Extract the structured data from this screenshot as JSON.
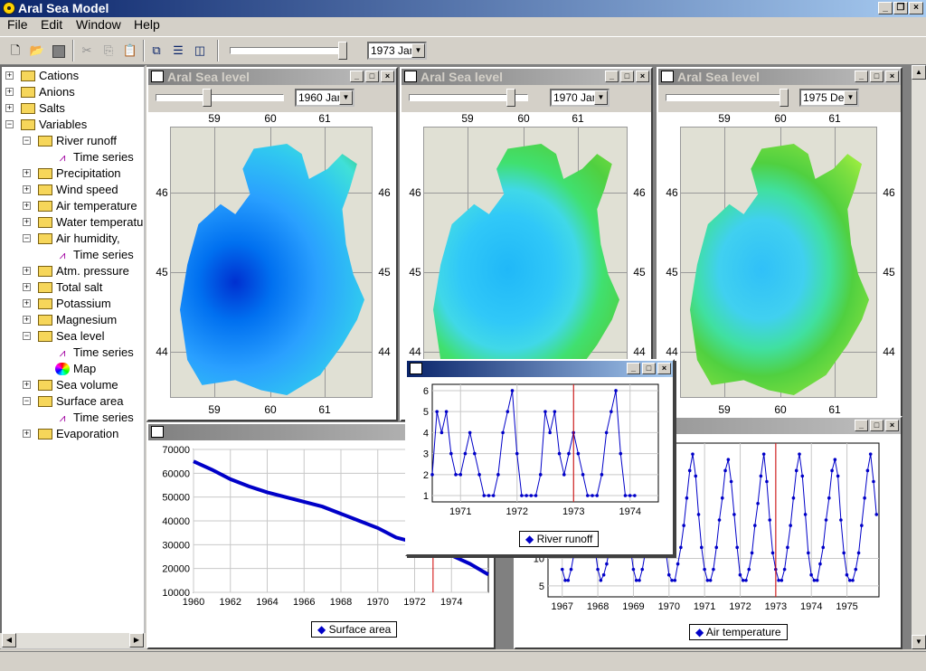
{
  "app": {
    "title": "Aral Sea Model"
  },
  "menu": [
    "File",
    "Edit",
    "Window",
    "Help"
  ],
  "toolbar": {
    "time_select": "1973 Jan"
  },
  "tree": {
    "items": [
      {
        "label": "Cations",
        "level": 0,
        "type": "folder",
        "expander": "+"
      },
      {
        "label": "Anions",
        "level": 0,
        "type": "folder",
        "expander": "+"
      },
      {
        "label": "Salts",
        "level": 0,
        "type": "folder",
        "expander": "+"
      },
      {
        "label": "Variables",
        "level": 0,
        "type": "folder",
        "expander": "-"
      },
      {
        "label": "River runoff",
        "level": 1,
        "type": "folder",
        "expander": "-"
      },
      {
        "label": "Time series",
        "level": 2,
        "type": "timeseries"
      },
      {
        "label": "Precipitation",
        "level": 1,
        "type": "folder",
        "expander": "+"
      },
      {
        "label": "Wind speed",
        "level": 1,
        "type": "folder",
        "expander": "+"
      },
      {
        "label": "Air temperature",
        "level": 1,
        "type": "folder",
        "expander": "+"
      },
      {
        "label": "Water temperatu",
        "level": 1,
        "type": "folder",
        "expander": "+"
      },
      {
        "label": "Air humidity,",
        "level": 1,
        "type": "folder",
        "expander": "-"
      },
      {
        "label": "Time series",
        "level": 2,
        "type": "timeseries"
      },
      {
        "label": "Atm. pressure",
        "level": 1,
        "type": "folder",
        "expander": "+"
      },
      {
        "label": "Total salt",
        "level": 1,
        "type": "folder",
        "expander": "+"
      },
      {
        "label": "Potassium",
        "level": 1,
        "type": "folder",
        "expander": "+"
      },
      {
        "label": "Magnesium",
        "level": 1,
        "type": "folder",
        "expander": "+"
      },
      {
        "label": "Sea level",
        "level": 1,
        "type": "folder",
        "expander": "-"
      },
      {
        "label": "Time series",
        "level": 2,
        "type": "timeseries"
      },
      {
        "label": "Map",
        "level": 2,
        "type": "map"
      },
      {
        "label": "Sea volume",
        "level": 1,
        "type": "folder",
        "expander": "+"
      },
      {
        "label": "Surface area",
        "level": 1,
        "type": "folder",
        "expander": "-"
      },
      {
        "label": "Time series",
        "level": 2,
        "type": "timeseries"
      },
      {
        "label": "Evaporation",
        "level": 1,
        "type": "folder",
        "expander": "+"
      }
    ]
  },
  "maps": [
    {
      "title": "Aral Sea level",
      "date": "1960 Jan",
      "lon_ticks": [
        "59",
        "60",
        "61"
      ],
      "lat_ticks": [
        "46",
        "45",
        "44"
      ]
    },
    {
      "title": "Aral Sea level",
      "date": "1970 Jan",
      "lon_ticks": [
        "59",
        "60",
        "61"
      ],
      "lat_ticks": [
        "46",
        "45",
        "44"
      ]
    },
    {
      "title": "Aral Sea level",
      "date": "1975 De",
      "lon_ticks": [
        "59",
        "60",
        "61"
      ],
      "lat_ticks": [
        "46",
        "45",
        "44"
      ]
    }
  ],
  "chart_data": [
    {
      "type": "line",
      "title": "",
      "series": [
        {
          "name": "Surface area"
        }
      ],
      "x": [
        1960,
        1961,
        1962,
        1963,
        1964,
        1965,
        1966,
        1967,
        1968,
        1969,
        1970,
        1971,
        1972,
        1973,
        1974,
        1975,
        1976
      ],
      "values": [
        65000,
        61500,
        57500,
        54500,
        52000,
        50000,
        48000,
        46000,
        43000,
        40000,
        37000,
        33000,
        31000,
        28500,
        25500,
        22000,
        17500
      ],
      "xlim": [
        1960,
        1976
      ],
      "ylim": [
        10000,
        70000
      ],
      "xticks": [
        "1960",
        "1962",
        "1964",
        "1966",
        "1968",
        "1970",
        "1972",
        "1974"
      ],
      "yticks": [
        "70000",
        "60000",
        "50000",
        "40000",
        "30000",
        "20000",
        "10000"
      ],
      "marker_x": 1973,
      "legend": "Surface area"
    },
    {
      "type": "line",
      "title": "",
      "series": [
        {
          "name": "Air temperature"
        }
      ],
      "x_start": 1967.0,
      "x_step": 0.0833,
      "values": [
        8,
        6,
        6,
        8,
        11,
        15,
        19,
        24,
        26,
        23,
        17,
        12,
        8,
        6,
        7,
        9,
        12,
        17,
        21,
        26,
        28,
        24,
        18,
        12,
        8,
        6,
        6,
        8,
        11,
        16,
        20,
        25,
        27,
        23,
        17,
        11,
        7,
        6,
        6,
        9,
        12,
        16,
        21,
        26,
        29,
        25,
        18,
        12,
        8,
        6,
        6,
        8,
        12,
        17,
        21,
        26,
        28,
        24,
        18,
        12,
        7,
        6,
        6,
        8,
        11,
        16,
        20,
        25,
        29,
        24,
        17,
        11,
        8,
        6,
        6,
        8,
        12,
        16,
        21,
        26,
        29,
        25,
        18,
        11,
        7,
        6,
        6,
        9,
        12,
        17,
        21,
        26,
        28,
        25,
        17,
        11,
        7,
        6,
        6,
        8,
        11,
        16,
        21,
        26,
        29,
        24,
        18,
        12,
        8
      ],
      "xlim": [
        1966.6,
        1975.9
      ],
      "ylim": [
        3,
        31
      ],
      "xticks": [
        "1967",
        "1968",
        "1969",
        "1970",
        "1971",
        "1972",
        "1973",
        "1974",
        "1975"
      ],
      "yticks": [
        "10",
        "5"
      ],
      "marker_x": 1973.0,
      "legend": "Air temperature"
    },
    {
      "type": "line",
      "title": "",
      "series": [
        {
          "name": "River runoff"
        }
      ],
      "x_start": 1970.5,
      "x_step": 0.0833,
      "values": [
        2,
        5,
        4,
        5,
        3,
        2,
        2,
        3,
        4,
        3,
        2,
        1,
        1,
        1,
        2,
        4,
        5,
        6,
        3,
        1,
        1,
        1,
        1,
        2,
        5,
        4,
        5,
        3,
        2,
        3,
        4,
        3,
        2,
        1,
        1,
        1,
        2,
        4,
        5,
        6,
        3,
        1,
        1,
        1
      ],
      "xlim": [
        1970.5,
        1974.5
      ],
      "ylim": [
        0.7,
        6.3
      ],
      "xticks": [
        "1971",
        "1972",
        "1973",
        "1974"
      ],
      "yticks": [
        "6",
        "5",
        "4",
        "3",
        "2",
        "1"
      ],
      "marker_x": 1973.0,
      "legend": "River runoff"
    }
  ]
}
